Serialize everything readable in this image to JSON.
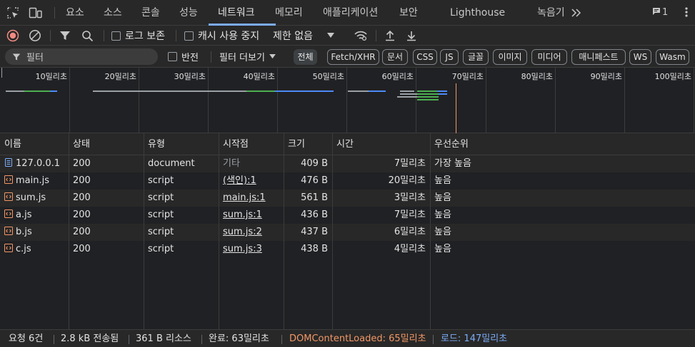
{
  "tabs": [
    {
      "label": "요소"
    },
    {
      "label": "소스"
    },
    {
      "label": "콘솔"
    },
    {
      "label": "성능"
    },
    {
      "label": "네트워크",
      "active": true
    },
    {
      "label": "메모리"
    },
    {
      "label": "애플리케이션"
    },
    {
      "label": "보안"
    },
    {
      "label": "Lighthouse"
    },
    {
      "label": "녹음기"
    }
  ],
  "tabbar": {
    "more_icon": "chevrons-right-icon",
    "message_count": "1"
  },
  "toolbar": {
    "preserve_log_label": "로그 보존",
    "disable_cache_label": "캐시 사용 중지",
    "throttling_value": "제한 없음"
  },
  "filterbar": {
    "filter_placeholder": "필터",
    "invert_label": "반전",
    "more_filters_label": "필터 더보기",
    "chips": [
      "전체",
      "Fetch/XHR",
      "문서",
      "CSS",
      "JS",
      "글꼴",
      "이미지",
      "미디어",
      "매니페스트",
      "WS",
      "Wasm"
    ]
  },
  "overview": {
    "ticks": [
      "10밀리초",
      "20밀리초",
      "30밀리초",
      "40밀리초",
      "50밀리초",
      "60밀리초",
      "70밀리초",
      "80밀리초",
      "90밀리초",
      "100밀리초"
    ]
  },
  "table": {
    "headers": [
      "이름",
      "상태",
      "유형",
      "시작점",
      "크기",
      "시간",
      "우선순위"
    ],
    "rows": [
      {
        "name": "127.0.0.1",
        "status": "200",
        "type": "document",
        "initiator": "기타",
        "size": "409 B",
        "time": "7밀리초",
        "priority": "가장 높음",
        "icon": "document-icon"
      },
      {
        "name": "main.js",
        "status": "200",
        "type": "script",
        "initiator": "(색인):1",
        "size": "476 B",
        "time": "20밀리초",
        "priority": "높음",
        "icon": "script-icon"
      },
      {
        "name": "sum.js",
        "status": "200",
        "type": "script",
        "initiator": "main.js:1",
        "size": "561 B",
        "time": "3밀리초",
        "priority": "높음",
        "icon": "script-icon"
      },
      {
        "name": "a.js",
        "status": "200",
        "type": "script",
        "initiator": "sum.js:1",
        "size": "436 B",
        "time": "7밀리초",
        "priority": "높음",
        "icon": "script-icon"
      },
      {
        "name": "b.js",
        "status": "200",
        "type": "script",
        "initiator": "sum.js:2",
        "size": "437 B",
        "time": "6밀리초",
        "priority": "높음",
        "icon": "script-icon"
      },
      {
        "name": "c.js",
        "status": "200",
        "type": "script",
        "initiator": "sum.js:3",
        "size": "438 B",
        "time": "4밀리초",
        "priority": "높음",
        "icon": "script-icon"
      }
    ]
  },
  "statusbar": {
    "requests": "요청 6건",
    "transferred": "2.8 kB 전송됨",
    "resources": "361 B 리소스",
    "finish": "완료: 63밀리초",
    "dom_content_loaded": "DOMContentLoaded: 65밀리초",
    "load": "로드: 147밀리초"
  },
  "colors": {
    "accent": "#7cacf8",
    "record": "#f28b82",
    "dcl": "#f29766",
    "load": "#7cacf8",
    "link": "#8ab4f8"
  }
}
